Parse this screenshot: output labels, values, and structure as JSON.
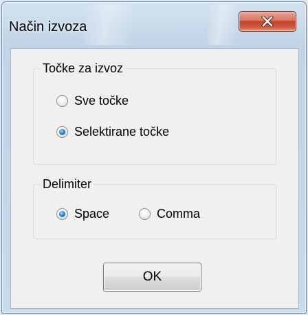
{
  "window": {
    "title": "Način izvoza",
    "close_icon": "close-x-icon"
  },
  "group_points": {
    "legend": "Točke za izvoz",
    "options": [
      {
        "label": "Sve točke",
        "checked": false
      },
      {
        "label": "Selektirane točke",
        "checked": true
      }
    ]
  },
  "group_delimiter": {
    "legend": "Delimiter",
    "options": [
      {
        "label": "Space",
        "checked": true
      },
      {
        "label": "Comma",
        "checked": false
      }
    ]
  },
  "buttons": {
    "ok_label": "OK"
  },
  "colors": {
    "close_button": "#c7412a",
    "radio_selected": "#2e8ad8",
    "client_background": "#f0f0f0"
  }
}
